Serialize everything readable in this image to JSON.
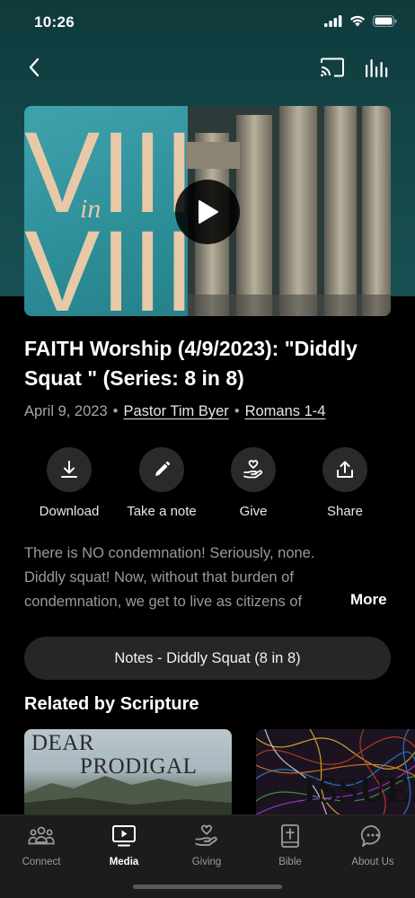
{
  "status": {
    "time": "10:26"
  },
  "icons": {
    "back": "chevron-left-icon",
    "cast": "cast-icon",
    "audio": "equalizer-icon",
    "play": "play-icon"
  },
  "video": {
    "thumbnail_text_top": "VIII",
    "thumbnail_text_mid": "in",
    "thumbnail_text_bottom": "VIII"
  },
  "sermon": {
    "title": "FAITH Worship (4/9/2023): \"Diddly Squat \" (Series: 8 in 8)",
    "date": "April 9, 2023",
    "speaker": "Pastor Tim Byer",
    "scripture": "Romans 1-4",
    "description": "There is NO condemnation! Seriously, none. Diddly squat! Now, without that burden of condemnation, we get to live as citizens of God's kingdom, free to love and serve.",
    "more_label": "More",
    "notes_label": "Notes - Diddly Squat (8 in 8)"
  },
  "actions": [
    {
      "label": "Download",
      "icon": "download-icon"
    },
    {
      "label": "Take a note",
      "icon": "pencil-icon"
    },
    {
      "label": "Give",
      "icon": "giving-hand-icon"
    },
    {
      "label": "Share",
      "icon": "share-icon"
    }
  ],
  "related": {
    "title": "Related by Scripture",
    "cards": [
      {
        "line1": "DEAR",
        "line2": "PRODIGAL"
      },
      {
        "text": "ISSUES"
      }
    ]
  },
  "tabs": [
    {
      "label": "Connect",
      "icon": "people-icon",
      "active": false
    },
    {
      "label": "Media",
      "icon": "media-icon",
      "active": true
    },
    {
      "label": "Giving",
      "icon": "giving-icon",
      "active": false
    },
    {
      "label": "Bible",
      "icon": "bible-icon",
      "active": false
    },
    {
      "label": "About Us",
      "icon": "chat-bubble-icon",
      "active": false
    }
  ],
  "colors": {
    "hero_teal": "#14484a",
    "background": "#000000",
    "button_gray": "#2a2a2a",
    "tabbar": "#1c1c1c"
  }
}
